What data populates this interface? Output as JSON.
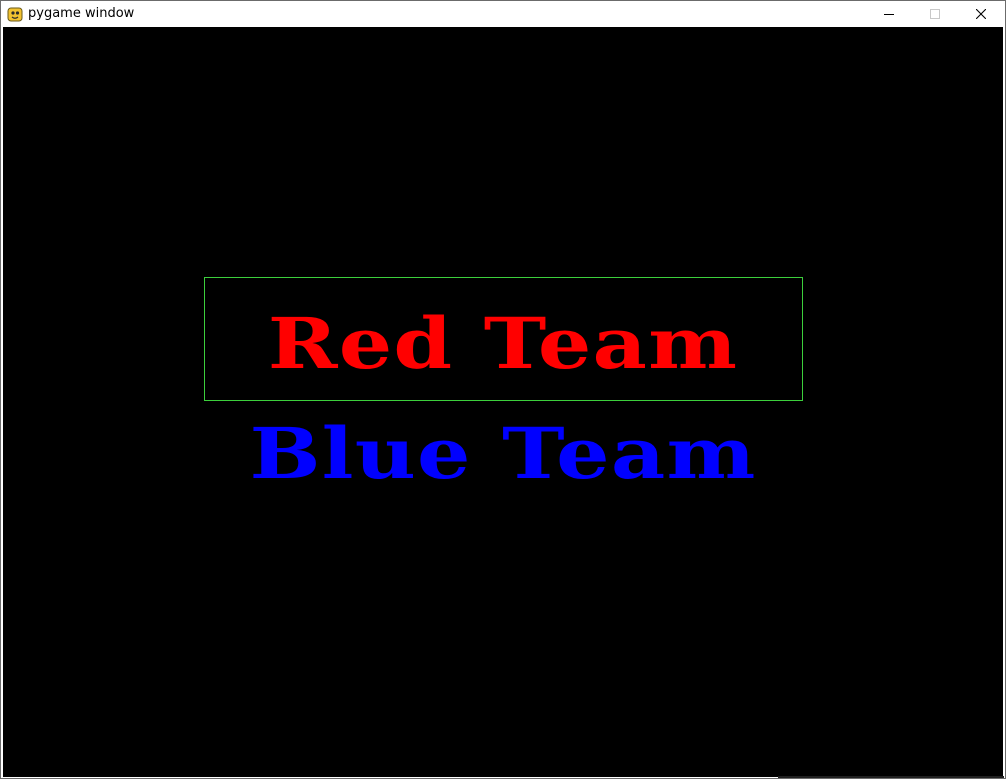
{
  "window": {
    "title": "pygame window",
    "controls": {
      "minimize_icon": "minimize-icon",
      "maximize_icon": "maximize-icon",
      "close_icon": "close-icon"
    }
  },
  "canvas": {
    "background": "#000000",
    "selection_border_color": "#3ccf3c",
    "teams": [
      {
        "label": "Red Team",
        "color": "#ff0000",
        "selected": true
      },
      {
        "label": "Blue Team",
        "color": "#0000ff",
        "selected": false
      }
    ]
  }
}
